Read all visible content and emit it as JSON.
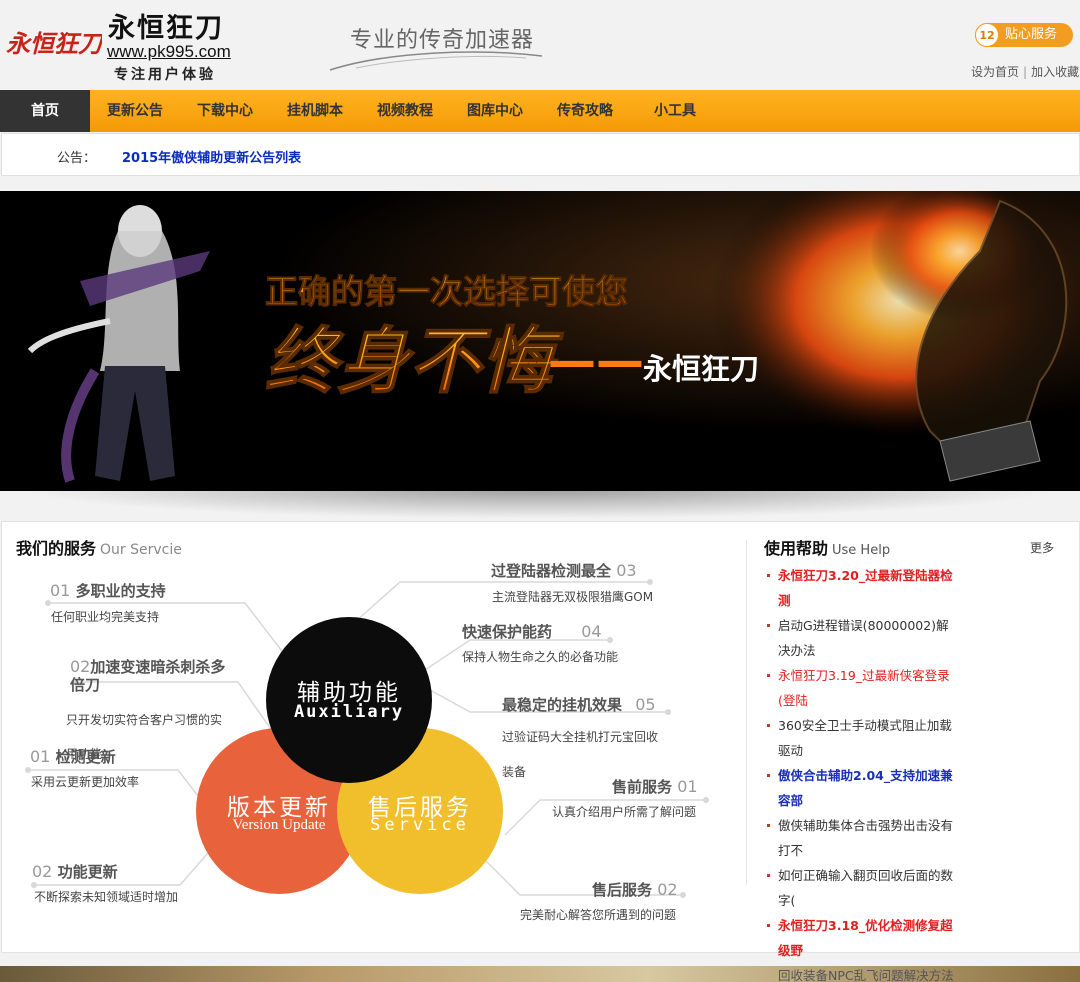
{
  "header": {
    "logo_mark": "永恒狂刀",
    "logo_title": "永恒狂刀",
    "logo_url": "www.pk995.com",
    "logo_slogan": "专注用户体验",
    "tagline": "专业的传奇加速器",
    "qq_badge": "12",
    "qq_button": "贴心服务",
    "set_home": "设为首页",
    "separator": "|",
    "add_favorite": "加入收藏"
  },
  "nav": {
    "items": [
      {
        "label": "首页"
      },
      {
        "label": "更新公告"
      },
      {
        "label": "下载中心"
      },
      {
        "label": "挂机脚本"
      },
      {
        "label": "视频教程"
      },
      {
        "label": "图库中心"
      },
      {
        "label": "传奇攻略"
      },
      {
        "label": "小工具"
      }
    ]
  },
  "notice": {
    "label": "公告：",
    "link": "2015年傲侠辅助更新公告列表"
  },
  "banner": {
    "line1": "正确的第一次选择可使您",
    "line2": "终身不悔",
    "dash": "——",
    "brand": "永恒狂刀"
  },
  "services": {
    "title": "我们的服务",
    "subtitle": "Our Servcie",
    "left": [
      {
        "num": "01",
        "title": "多职业的支持",
        "desc": "任何职业均完美支持"
      },
      {
        "num": "02",
        "title": "加速变速暗杀刺杀多倍刀",
        "desc": "只开发切实符合客户习惯的实用功能"
      },
      {
        "num": "01",
        "title": "检测更新",
        "desc": "采用云更新更加效率"
      },
      {
        "num": "02",
        "title": "功能更新",
        "desc": "不断探索未知领域适时增加"
      }
    ],
    "right": [
      {
        "num": "03",
        "title": "过登陆器检测最全",
        "desc": "主流登陆器无双极限猎鹰GOM"
      },
      {
        "num": "04",
        "title": "快速保护能药",
        "desc": "保持人物生命之久的必备功能"
      },
      {
        "num": "05",
        "title": "最稳定的挂机效果",
        "desc": "过验证码大全挂机打元宝回收装备"
      },
      {
        "num": "01",
        "title": "售前服务",
        "desc": "认真介绍用户所需了解问题"
      },
      {
        "num": "02",
        "title": "售后服务",
        "desc": "完美耐心解答您所遇到的问题"
      }
    ],
    "circles": {
      "aux_cn": "辅助功能",
      "aux_en": "Auxiliary",
      "ver_cn": "版本更新",
      "ver_en": "Version Update",
      "svc_cn": "售后服务",
      "svc_en": "Service"
    },
    "colors": {
      "aux": "#0c0c0c",
      "ver": "#e8623c",
      "svc": "#f2bf2c"
    }
  },
  "help": {
    "title": "使用帮助",
    "subtitle": "Use Help",
    "more": "更多",
    "items": [
      {
        "text": "永恒狂刀3.20_过最新登陆器检测",
        "style": "red"
      },
      {
        "text": "启动G进程错误(80000002)解决办法",
        "style": "normal"
      },
      {
        "text": "永恒狂刀3.19_过最新侠客登录(登陆",
        "style": "red-light"
      },
      {
        "text": "360安全卫士手动模式阻止加载驱动",
        "style": "normal"
      },
      {
        "text": "傲侠合击辅助2.04_支持加速兼容部",
        "style": "blue"
      },
      {
        "text": "傲侠辅助集体合击强势出击没有打不",
        "style": "normal"
      },
      {
        "text": "如何正确输入翻页回收后面的数字(",
        "style": "normal"
      },
      {
        "text": "永恒狂刀3.18_优化检测修复超级野",
        "style": "red"
      },
      {
        "text": "回收装备NPC乱飞问题解决方法",
        "style": "normal"
      }
    ]
  }
}
